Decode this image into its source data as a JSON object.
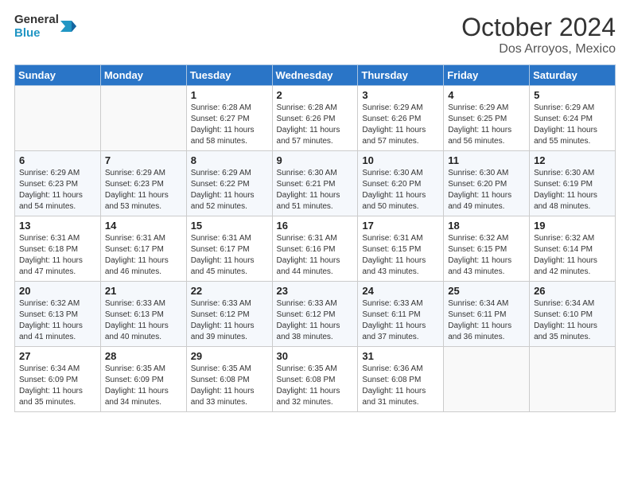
{
  "header": {
    "logo": {
      "line1": "General",
      "line2": "Blue"
    },
    "month": "October 2024",
    "location": "Dos Arroyos, Mexico"
  },
  "weekdays": [
    "Sunday",
    "Monday",
    "Tuesday",
    "Wednesday",
    "Thursday",
    "Friday",
    "Saturday"
  ],
  "weeks": [
    [
      {
        "day": "",
        "info": ""
      },
      {
        "day": "",
        "info": ""
      },
      {
        "day": "1",
        "info": "Sunrise: 6:28 AM\nSunset: 6:27 PM\nDaylight: 11 hours and 58 minutes."
      },
      {
        "day": "2",
        "info": "Sunrise: 6:28 AM\nSunset: 6:26 PM\nDaylight: 11 hours and 57 minutes."
      },
      {
        "day": "3",
        "info": "Sunrise: 6:29 AM\nSunset: 6:26 PM\nDaylight: 11 hours and 57 minutes."
      },
      {
        "day": "4",
        "info": "Sunrise: 6:29 AM\nSunset: 6:25 PM\nDaylight: 11 hours and 56 minutes."
      },
      {
        "day": "5",
        "info": "Sunrise: 6:29 AM\nSunset: 6:24 PM\nDaylight: 11 hours and 55 minutes."
      }
    ],
    [
      {
        "day": "6",
        "info": "Sunrise: 6:29 AM\nSunset: 6:23 PM\nDaylight: 11 hours and 54 minutes."
      },
      {
        "day": "7",
        "info": "Sunrise: 6:29 AM\nSunset: 6:23 PM\nDaylight: 11 hours and 53 minutes."
      },
      {
        "day": "8",
        "info": "Sunrise: 6:29 AM\nSunset: 6:22 PM\nDaylight: 11 hours and 52 minutes."
      },
      {
        "day": "9",
        "info": "Sunrise: 6:30 AM\nSunset: 6:21 PM\nDaylight: 11 hours and 51 minutes."
      },
      {
        "day": "10",
        "info": "Sunrise: 6:30 AM\nSunset: 6:20 PM\nDaylight: 11 hours and 50 minutes."
      },
      {
        "day": "11",
        "info": "Sunrise: 6:30 AM\nSunset: 6:20 PM\nDaylight: 11 hours and 49 minutes."
      },
      {
        "day": "12",
        "info": "Sunrise: 6:30 AM\nSunset: 6:19 PM\nDaylight: 11 hours and 48 minutes."
      }
    ],
    [
      {
        "day": "13",
        "info": "Sunrise: 6:31 AM\nSunset: 6:18 PM\nDaylight: 11 hours and 47 minutes."
      },
      {
        "day": "14",
        "info": "Sunrise: 6:31 AM\nSunset: 6:17 PM\nDaylight: 11 hours and 46 minutes."
      },
      {
        "day": "15",
        "info": "Sunrise: 6:31 AM\nSunset: 6:17 PM\nDaylight: 11 hours and 45 minutes."
      },
      {
        "day": "16",
        "info": "Sunrise: 6:31 AM\nSunset: 6:16 PM\nDaylight: 11 hours and 44 minutes."
      },
      {
        "day": "17",
        "info": "Sunrise: 6:31 AM\nSunset: 6:15 PM\nDaylight: 11 hours and 43 minutes."
      },
      {
        "day": "18",
        "info": "Sunrise: 6:32 AM\nSunset: 6:15 PM\nDaylight: 11 hours and 43 minutes."
      },
      {
        "day": "19",
        "info": "Sunrise: 6:32 AM\nSunset: 6:14 PM\nDaylight: 11 hours and 42 minutes."
      }
    ],
    [
      {
        "day": "20",
        "info": "Sunrise: 6:32 AM\nSunset: 6:13 PM\nDaylight: 11 hours and 41 minutes."
      },
      {
        "day": "21",
        "info": "Sunrise: 6:33 AM\nSunset: 6:13 PM\nDaylight: 11 hours and 40 minutes."
      },
      {
        "day": "22",
        "info": "Sunrise: 6:33 AM\nSunset: 6:12 PM\nDaylight: 11 hours and 39 minutes."
      },
      {
        "day": "23",
        "info": "Sunrise: 6:33 AM\nSunset: 6:12 PM\nDaylight: 11 hours and 38 minutes."
      },
      {
        "day": "24",
        "info": "Sunrise: 6:33 AM\nSunset: 6:11 PM\nDaylight: 11 hours and 37 minutes."
      },
      {
        "day": "25",
        "info": "Sunrise: 6:34 AM\nSunset: 6:11 PM\nDaylight: 11 hours and 36 minutes."
      },
      {
        "day": "26",
        "info": "Sunrise: 6:34 AM\nSunset: 6:10 PM\nDaylight: 11 hours and 35 minutes."
      }
    ],
    [
      {
        "day": "27",
        "info": "Sunrise: 6:34 AM\nSunset: 6:09 PM\nDaylight: 11 hours and 35 minutes."
      },
      {
        "day": "28",
        "info": "Sunrise: 6:35 AM\nSunset: 6:09 PM\nDaylight: 11 hours and 34 minutes."
      },
      {
        "day": "29",
        "info": "Sunrise: 6:35 AM\nSunset: 6:08 PM\nDaylight: 11 hours and 33 minutes."
      },
      {
        "day": "30",
        "info": "Sunrise: 6:35 AM\nSunset: 6:08 PM\nDaylight: 11 hours and 32 minutes."
      },
      {
        "day": "31",
        "info": "Sunrise: 6:36 AM\nSunset: 6:08 PM\nDaylight: 11 hours and 31 minutes."
      },
      {
        "day": "",
        "info": ""
      },
      {
        "day": "",
        "info": ""
      }
    ]
  ],
  "accent_color": "#2a75c7"
}
